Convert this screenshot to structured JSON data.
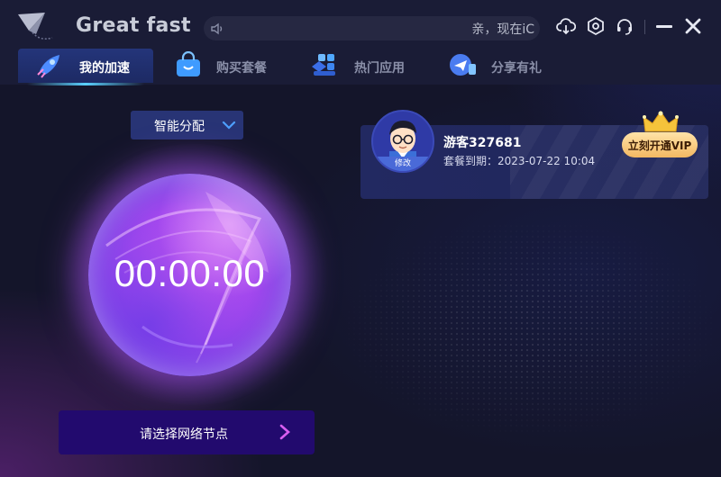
{
  "app": {
    "brand": "Great fast"
  },
  "titlebar": {
    "notice_text": "亲，现在iC",
    "icons": [
      "speaker-icon",
      "cloud-download-icon",
      "settings-hex-icon",
      "headset-icon",
      "minimize-icon",
      "close-icon"
    ]
  },
  "tabs": [
    {
      "label": "我的加速",
      "icon": "rocket-icon",
      "active": true
    },
    {
      "label": "购买套餐",
      "icon": "shopping-bag-icon",
      "active": false
    },
    {
      "label": "热门应用",
      "icon": "apps-grid-icon",
      "active": false
    },
    {
      "label": "分享有礼",
      "icon": "share-gift-icon",
      "active": false
    }
  ],
  "mode_select": {
    "value": "智能分配"
  },
  "timer": {
    "value": "00:00:00"
  },
  "node_button": {
    "label": "请选择网络节点"
  },
  "user": {
    "name": "游客327681",
    "expire_text": "套餐到期：2023-07-22 10:04",
    "avatar_edit": "修改",
    "vip_button": "立刻开通VIP"
  },
  "colors": {
    "background": "#14152a",
    "titlebar": "#1a1c36",
    "tab_active": "#24357a",
    "orb_primary": "#d45cf3",
    "orb_secondary": "#6a3fe0",
    "node_button": "#220a6e",
    "vip_gold": "#f3b862",
    "arrow_accent": "#d85ef0"
  }
}
